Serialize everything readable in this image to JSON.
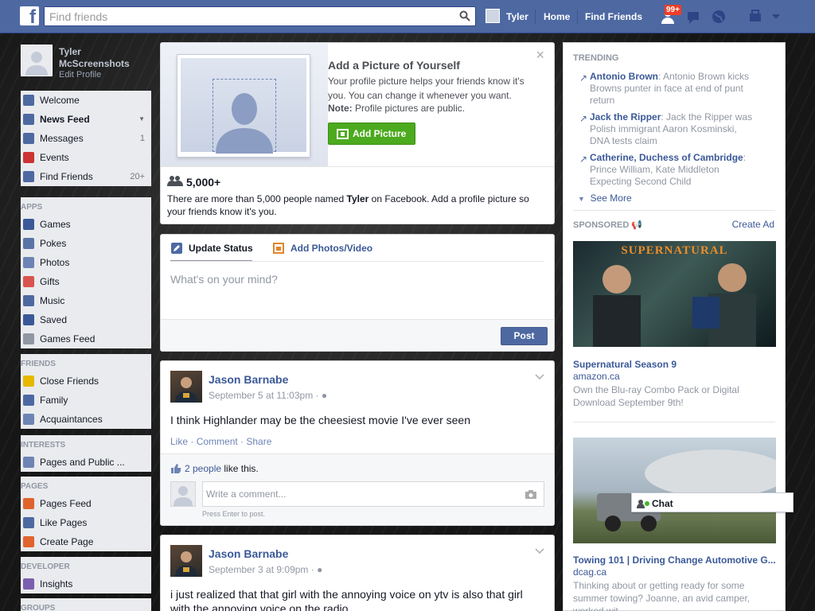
{
  "topbar": {
    "logo_letter": "f",
    "search_placeholder": "Find friends",
    "user_name": "Tyler",
    "home": "Home",
    "find_friends": "Find Friends",
    "notif_badge": "99+",
    "icons": [
      "friend-requests-icon",
      "messages-icon",
      "notifications-globe-icon",
      "privacy-shortcuts-icon",
      "account-menu-chevron-icon"
    ]
  },
  "profile": {
    "name": "Tyler McScreenshots",
    "edit": "Edit Profile"
  },
  "favorites": [
    {
      "label": "Welcome",
      "icon": "welcome-icon",
      "count": "",
      "color": "#4e69a2"
    },
    {
      "label": "News Feed",
      "icon": "news-feed-icon",
      "count": "",
      "color": "#4e69a2",
      "bold": true
    },
    {
      "label": "Messages",
      "icon": "messages-icon",
      "count": "1",
      "color": "#4e69a2"
    },
    {
      "label": "Events",
      "icon": "events-calendar-icon",
      "count": "",
      "color": "#cc3333"
    },
    {
      "label": "Find Friends",
      "icon": "find-friends-icon",
      "count": "20+",
      "color": "#4e69a2"
    }
  ],
  "apps_heading": "APPS",
  "apps": [
    {
      "label": "Games",
      "color": "#3b5998"
    },
    {
      "label": "Pokes",
      "color": "#5b74a8"
    },
    {
      "label": "Photos",
      "color": "#6d84b4"
    },
    {
      "label": "Gifts",
      "color": "#d9534f"
    },
    {
      "label": "Music",
      "color": "#4e69a2"
    },
    {
      "label": "Saved",
      "color": "#3b5998"
    },
    {
      "label": "Games Feed",
      "color": "#9197a3"
    }
  ],
  "friends_heading": "FRIENDS",
  "friends": [
    {
      "label": "Close Friends",
      "color": "#e6b800"
    },
    {
      "label": "Family",
      "color": "#4e69a2"
    },
    {
      "label": "Acquaintances",
      "color": "#6d84b4"
    }
  ],
  "interests_heading": "INTERESTS",
  "interests": [
    {
      "label": "Pages and Public ...",
      "color": "#6d84b4"
    }
  ],
  "pages_heading": "PAGES",
  "pages": [
    {
      "label": "Pages Feed",
      "color": "#e0642e"
    },
    {
      "label": "Like Pages",
      "color": "#4e69a2"
    },
    {
      "label": "Create Page",
      "color": "#e0642e"
    }
  ],
  "developer_heading": "DEVELOPER",
  "developer": [
    {
      "label": "Insights",
      "color": "#7a5fb0"
    }
  ],
  "groups_heading": "GROUPS",
  "add_picture": {
    "title": "Add a Picture of Yourself",
    "body": "Your profile picture helps your friends know it's you. You can change it whenever you want.",
    "note_label": "Note:",
    "note_text": "Profile pictures are public.",
    "button": "Add Picture",
    "close": "×",
    "count": "5,000+",
    "more_pre": "There are more than 5,000 people named",
    "more_name": "Tyler",
    "more_post": "on Facebook. Add a profile picture so your friends know it's you."
  },
  "composer": {
    "tab_status": "Update Status",
    "tab_photos": "Add Photos/Video",
    "placeholder": "What's on your mind?",
    "post": "Post"
  },
  "posts": [
    {
      "author": "Jason Barnabe",
      "time": "September 5 at 11:03pm",
      "text": "I think Highlander may be the cheesiest movie I've ever seen",
      "like": "Like",
      "comment": "Comment",
      "share": "Share",
      "likes_link": "2 people",
      "likes_text": "like this.",
      "comment_placeholder": "Write a comment...",
      "enter_hint": "Press Enter to post."
    },
    {
      "author": "Jason Barnabe",
      "time": "September 3 at 9:09pm",
      "text": "i just realized that that girl with the annoying voice on ytv is also that girl with the annoying voice on the radio"
    }
  ],
  "trending": {
    "heading": "TRENDING",
    "items": [
      {
        "topic": "Antonio Brown",
        "desc": ": Antonio Brown kicks Browns punter in face at end of punt return"
      },
      {
        "topic": "Jack the Ripper",
        "desc": ": Jack the Ripper was Polish immigrant Aaron Kosminski, DNA tests claim"
      },
      {
        "topic": "Catherine, Duchess of Cambridge",
        "desc": ": Prince William, Kate Middleton Expecting Second Child"
      }
    ],
    "see_more": "See More"
  },
  "sponsored": {
    "heading": "SPONSORED",
    "create_ad": "Create Ad",
    "ads": [
      {
        "image_caption": "SUPERNATURAL",
        "title": "Supernatural Season 9",
        "domain": "amazon.ca",
        "desc": "Own the Blu-ray Combo Pack or Digital Download September 9th!"
      },
      {
        "title": "Towing 101 | Driving Change Automotive G...",
        "domain": "dcag.ca",
        "desc": "Thinking about or getting ready for some summer towing? Joanne, an avid camper, worked wit"
      }
    ]
  },
  "chat": {
    "label": "Chat"
  },
  "colors": {
    "brand": "#4e69a2",
    "link": "#3b5998",
    "green": "#4caa1e"
  }
}
